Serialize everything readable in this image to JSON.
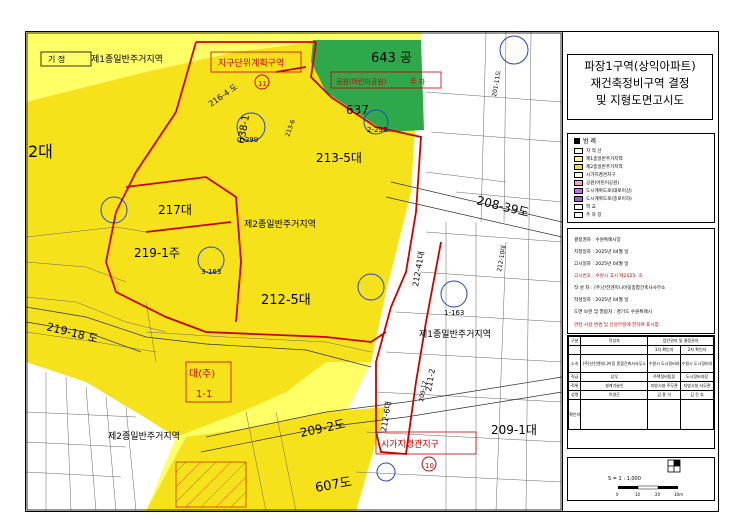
{
  "map": {
    "labels": {
      "existing_box": "기  정",
      "zone_top": "제1종일반주거지역",
      "zone_center": "제2종일반주거지역",
      "zone_right": "제1종일반주거지역",
      "zone_bottom": "제2종일반주거지역",
      "park_643": "643 공",
      "parcel_213_5": "213-5대",
      "parcel_212_5": "212-5대",
      "parcel_217": "217대",
      "parcel_219_1": "219-1주",
      "parcel_2_left": "2대",
      "parcel_219_18": "219-18 도",
      "parcel_209_2": "209-2도",
      "parcel_209_1": "209-1대",
      "parcel_208_39": "208-39도",
      "parcel_607": "607도",
      "parcel_637": "637",
      "parcel_216_4": "216-4 도",
      "parcel_638_1": "638-1",
      "parcel_213_6": "213-6",
      "parcel_212_6": "212-6대",
      "parcel_212_41": "212-41대",
      "parcel_212_10": "212-10대",
      "parcel_211_2": "211-2",
      "parcel_201_11": "201-11도",
      "parcel_209_12": "209-12",
      "circle_2_293": "2-293",
      "circle_1_299": "1-299",
      "circle_3_163": "3-163",
      "circle_1_163": "1-163",
      "daeju": "대(주)",
      "one_one": "1-1",
      "jigu_top": "지구단위계획구역",
      "jigu_bottom": "시가지경관지구",
      "jigu_park": "공원(어린이공원)",
      "gong_small": "주 차",
      "marker_11": "11",
      "marker_10": "10"
    }
  },
  "panel": {
    "title": [
      "파장1구역(상익아파트)",
      "재건축정비구역 결정",
      "및 지형도면고시도"
    ],
    "legend": {
      "heading": "범  례",
      "items": [
        {
          "label": "지 적 선",
          "color": "#ffffff"
        },
        {
          "label": "제1종일반주거지역",
          "color": "#ffff66"
        },
        {
          "label": "제2종일반주거지역",
          "color": "#f6e21a"
        },
        {
          "label": "시가지경관지구",
          "color": "#ffffff"
        },
        {
          "label": "공원(어린이공원)",
          "color": "#ff99cc"
        },
        {
          "label": "도시계획도로(대로이상)",
          "color": "#cc66ff"
        },
        {
          "label": "도시계획도로(중로이하)",
          "color": "#9966cc"
        },
        {
          "label": "학    교",
          "color": "#ffffff"
        },
        {
          "label": "주 차 장",
          "color": "#ffffff"
        }
      ]
    },
    "info": [
      "결정권자 : 수원특례시장",
      "지정일자 : 2025년 04월   일",
      "고시일자 : 2025년 04월   일",
      "고시번호 : 수원시 고시 제2025-    호",
      "작 성 자 : (주)선진엔지니어링종합건축사사무소",
      "작성일자 : 2025년 04월   일",
      "도면 보관 및 열람처 : 경기도 수원특례시",
      "관련 사항 변경 및 신설부분에 한하여 표시함"
    ],
    "table": [
      [
        "구분",
        "작성자",
        "입안권자 및 결정권자",
        ""
      ],
      [
        "",
        "",
        "1차 확인자",
        "2차 확인자"
      ],
      [
        "소속",
        "(주)선진엔지니어링 종합건축사사무소",
        "수원시 도시정비과",
        "수원시 도시정비과"
      ],
      [
        "직급",
        "상무",
        "주택정비팀장",
        "도시정비과장"
      ],
      [
        "직위",
        "설계기술인",
        "지방시설 주무관",
        "지방시설 사무관"
      ],
      [
        "성명",
        "이영곤",
        "김 용 식",
        "김 진 호"
      ],
      [
        "확인자",
        "",
        "",
        ""
      ]
    ],
    "scale": {
      "label": "S = 1 : 1,000",
      "ticks": [
        "0",
        "10",
        "20",
        "30m"
      ]
    }
  },
  "colors": {
    "zone1": "#ffff66",
    "zone2": "#f6e21a",
    "park": "#2ea84a",
    "boundary_red": "#cc0000",
    "circle_blue": "#2244cc",
    "parcel_line": "#555555"
  }
}
